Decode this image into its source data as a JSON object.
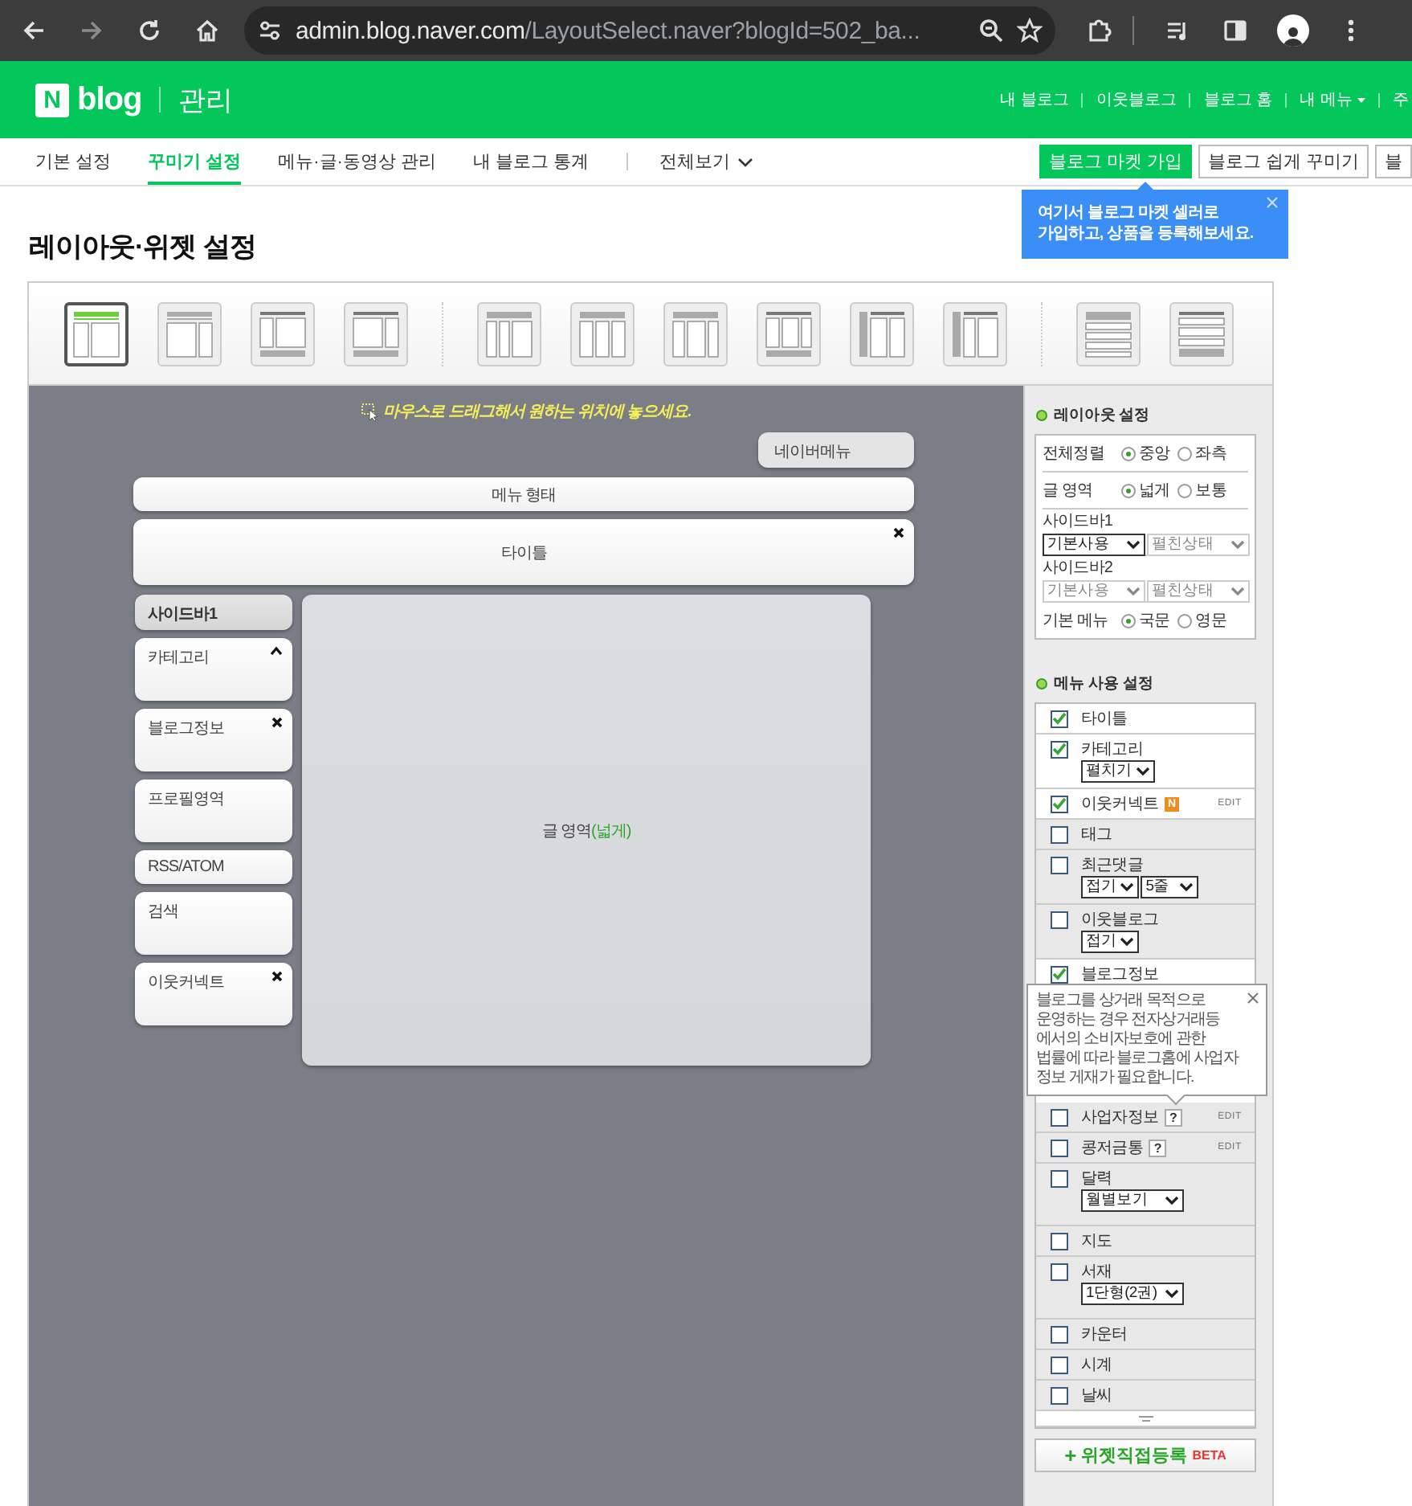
{
  "browser": {
    "url_host": "admin.blog.naver.com",
    "url_path": "/LayoutSelect.naver?blogId=502_ba..."
  },
  "header": {
    "logo_mark": "N",
    "logo_text": "blog",
    "section": "관리",
    "links": [
      {
        "label": "내 블로그",
        "dropdown": false
      },
      {
        "label": "이웃블로그",
        "dropdown": false
      },
      {
        "label": "블로그 홈",
        "dropdown": false
      },
      {
        "label": "내 메뉴",
        "dropdown": true
      },
      {
        "label": "주",
        "dropdown": false
      }
    ]
  },
  "tabs": [
    {
      "label": "기본 설정",
      "selected": false
    },
    {
      "label": "꾸미기 설정",
      "selected": true
    },
    {
      "label": "메뉴·글·동영상 관리",
      "selected": false
    },
    {
      "label": "내 블로그 통계",
      "selected": false
    }
  ],
  "all_view": "전체보기",
  "action_buttons": [
    {
      "label": "블로그 마켓 가입",
      "kind": "primary"
    },
    {
      "label": "블로그 쉽게 꾸미기",
      "kind": "outline"
    },
    {
      "label": "블",
      "kind": "outline"
    }
  ],
  "market_tip": {
    "lines": [
      "여기서 블로그 마켓 셀러로",
      "가입하고, 상품을 등록해보세요."
    ]
  },
  "page_title": "레이아웃·위젯 설정",
  "layout_groups": [
    [
      {
        "selected": true
      },
      {
        "selected": false
      },
      {
        "selected": false
      },
      {
        "selected": false
      }
    ],
    [
      {
        "selected": false
      },
      {
        "selected": false
      },
      {
        "selected": false
      },
      {
        "selected": false
      },
      {
        "selected": false
      },
      {
        "selected": false
      }
    ],
    [
      {
        "selected": false
      },
      {
        "selected": false
      }
    ]
  ],
  "canvas": {
    "hint": "마우스로 드래그해서 원하는 위치에 놓으세요.",
    "naver_menu": "네이버메뉴",
    "menu_form": "메뉴 형태",
    "title_block": {
      "label": "타이틀",
      "removable": true
    },
    "sidebar_header": "사이드바1",
    "sidebar_widgets": [
      {
        "label": "카테고리",
        "kind": "tall",
        "collapsible": true,
        "removable": false
      },
      {
        "label": "블로그정보",
        "kind": "tall",
        "collapsible": false,
        "removable": true
      },
      {
        "label": "프로필영역",
        "kind": "tall",
        "collapsible": false,
        "removable": false
      },
      {
        "label": "RSS/ATOM",
        "kind": "short",
        "collapsible": false,
        "removable": false
      },
      {
        "label": "검색",
        "kind": "tall",
        "collapsible": false,
        "removable": false
      },
      {
        "label": "이웃커넥트",
        "kind": "tall",
        "collapsible": false,
        "removable": true
      }
    ],
    "content_area": {
      "label": "글 영역",
      "note": "(넓게)"
    }
  },
  "layout_settings": {
    "title": "레이아웃 설정",
    "rows": [
      {
        "kind": "radio",
        "label": "전체정렬",
        "options": [
          {
            "label": "중앙",
            "selected": true
          },
          {
            "label": "좌측",
            "selected": false
          }
        ]
      },
      {
        "kind": "radio",
        "label": "글 영역",
        "options": [
          {
            "label": "넓게",
            "selected": true
          },
          {
            "label": "보통",
            "selected": false
          }
        ]
      },
      {
        "kind": "selects",
        "label": "사이드바1",
        "selects": [
          {
            "value": "기본사용",
            "disabled": false
          },
          {
            "value": "펼친상태",
            "disabled": true
          }
        ]
      },
      {
        "kind": "selects",
        "label": "사이드바2",
        "selects": [
          {
            "value": "기본사용",
            "disabled": true
          },
          {
            "value": "펼친상태",
            "disabled": true
          }
        ]
      },
      {
        "kind": "radio",
        "label": "기본 메뉴",
        "options": [
          {
            "label": "국문",
            "selected": true
          },
          {
            "label": "영문",
            "selected": false
          }
        ]
      }
    ]
  },
  "menu_settings": {
    "title": "메뉴 사용 설정",
    "items": [
      {
        "label": "타이틀",
        "checked": true
      },
      {
        "label": "카테고리",
        "checked": true,
        "selects": [
          {
            "value": "펼치기"
          }
        ]
      },
      {
        "label": "이웃커넥트",
        "checked": true,
        "badge": "N",
        "edit": "EDIT"
      },
      {
        "label": "태그",
        "checked": false
      },
      {
        "label": "최근댓글",
        "checked": false,
        "selects": [
          {
            "value": "접기"
          },
          {
            "value": "5줄"
          }
        ]
      },
      {
        "label": "이웃블로그",
        "checked": false,
        "selects": [
          {
            "value": "접기"
          }
        ]
      },
      {
        "label": "블로그정보",
        "checked": true
      },
      {
        "label": "사업자정보",
        "checked": false,
        "help": "?",
        "edit": "EDIT"
      },
      {
        "label": "콩저금통",
        "checked": false,
        "help": "?",
        "edit": "EDIT"
      },
      {
        "label": "달력",
        "checked": false,
        "selects": [
          {
            "value": "월별보기"
          }
        ]
      },
      {
        "label": "지도",
        "checked": false
      },
      {
        "label": "서재",
        "checked": false,
        "selects": [
          {
            "value": "1단형(2권)"
          }
        ]
      },
      {
        "label": "카운터",
        "checked": false
      },
      {
        "label": "시계",
        "checked": false
      },
      {
        "label": "날씨",
        "checked": false
      }
    ]
  },
  "business_tip": {
    "lines": [
      "블로그를 상거래 목적으로",
      "운영하는 경우 전자상거래등",
      "에서의 소비자보호에 관한",
      "법률에 따라 블로그홈에 사업자",
      "정보 게재가 필요합니다."
    ]
  },
  "widget_button": {
    "icon": "+",
    "label": "위젯직접등록",
    "tag": "BETA"
  }
}
